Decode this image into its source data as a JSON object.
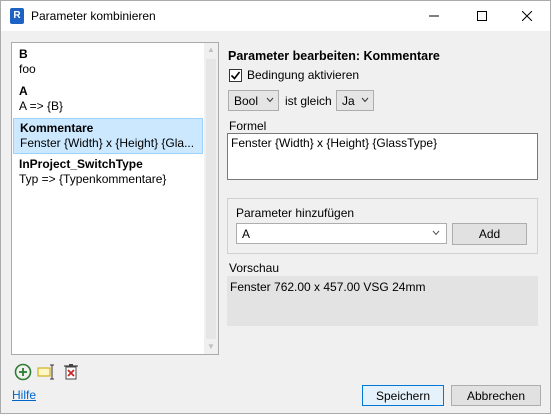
{
  "window": {
    "icon_letter": "R",
    "title": "Parameter kombinieren"
  },
  "list": {
    "items": [
      {
        "title": "B",
        "subtitle": "foo",
        "selected": false
      },
      {
        "title": "A",
        "subtitle": "A => {B}",
        "selected": false
      },
      {
        "title": "Kommentare",
        "subtitle": "Fenster {Width} x {Height} {Gla...",
        "selected": true
      },
      {
        "title": "InProject_SwitchType",
        "subtitle": "Typ => {Typenkommentare}",
        "selected": false
      }
    ]
  },
  "toolbar": {
    "icons": [
      "add-icon",
      "rename-icon",
      "delete-icon"
    ],
    "add_color": "#2e7d32",
    "delete_color": "#c62828"
  },
  "help": {
    "label": "Hilfe"
  },
  "editor": {
    "title": "Parameter bearbeiten: Kommentare",
    "condition_label": "Bedingung aktivieren",
    "condition_checked": true,
    "condition_left": "Bool",
    "equals_label": "ist gleich",
    "condition_right": "Ja",
    "formula_label": "Formel",
    "formula_value": "Fenster {Width} x {Height} {GlassType}",
    "add_param_group": "Parameter hinzufügen",
    "add_param_selected": "A",
    "add_button": "Add",
    "preview_label": "Vorschau",
    "preview_value": "Fenster 762.00 x 457.00 VSG 24mm"
  },
  "buttons": {
    "save": "Speichern",
    "cancel": "Abbrechen"
  },
  "colors": {
    "selection_bg": "#cce8ff",
    "link": "#0066cc",
    "accent": "#0078d7"
  }
}
